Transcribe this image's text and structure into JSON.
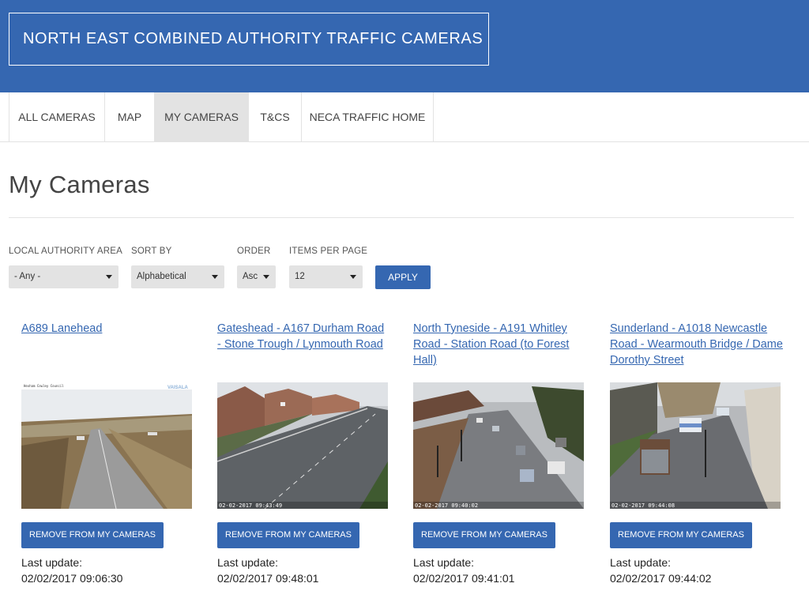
{
  "header": {
    "title": "NORTH EAST COMBINED AUTHORITY TRAFFIC CAMERAS"
  },
  "nav": {
    "items": [
      {
        "label": "ALL CAMERAS"
      },
      {
        "label": "MAP"
      },
      {
        "label": "MY CAMERAS",
        "active": true
      },
      {
        "label": "T&CS"
      },
      {
        "label": "NECA TRAFFIC HOME"
      }
    ]
  },
  "page": {
    "title": "My Cameras"
  },
  "filters": {
    "area": {
      "label": "LOCAL AUTHORITY AREA",
      "value": "- Any -"
    },
    "sort": {
      "label": "SORT BY",
      "value": "Alphabetical"
    },
    "order": {
      "label": "ORDER",
      "value": "Asc"
    },
    "per_page": {
      "label": "ITEMS PER PAGE",
      "value": "12"
    },
    "apply_label": "APPLY"
  },
  "cameras": [
    {
      "title": "A689 Lanehead",
      "image_desc": "rural moorland road with snow-dusted verges",
      "stamp": "",
      "watermark": "VAISALA",
      "remove_label": "REMOVE FROM MY CAMERAS",
      "update_label": "Last update:",
      "updated": "02/02/2017 09:06:30"
    },
    {
      "title": "Gateshead - A167 Durham Road - Stone Trough / Lynmouth Road",
      "image_desc": "dual carriageway beside houses",
      "stamp": "02-02-2017 09:43:49",
      "remove_label": "REMOVE FROM MY CAMERAS",
      "update_label": "Last update:",
      "updated": "02/02/2017 09:48:01"
    },
    {
      "title": "North Tyneside - A191 Whitley Road - Station Road (to Forest Hall)",
      "image_desc": "urban junction with traffic lights and cars",
      "stamp": "02-02-2017 09:40:02",
      "remove_label": "REMOVE FROM MY CAMERAS",
      "update_label": "Last update:",
      "updated": "02/02/2017 09:41:01"
    },
    {
      "title": "Sunderland - A1018 Newcastle Road - Wearmouth Bridge / Dame Dorothy Street",
      "image_desc": "city road with buses and lorry",
      "stamp": "02-02-2017 09:44:08",
      "remove_label": "REMOVE FROM MY CAMERAS",
      "update_label": "Last update:",
      "updated": "02/02/2017 09:44:02"
    }
  ],
  "colors": {
    "primary": "#3567b1",
    "nav_active": "#e3e3e3",
    "text": "#333333"
  }
}
